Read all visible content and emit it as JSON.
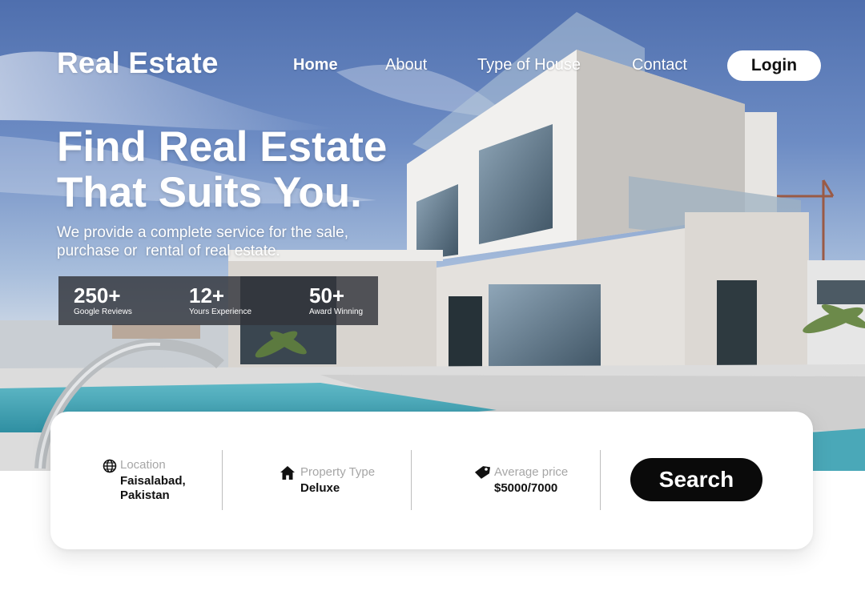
{
  "brand": {
    "logo": "Real Estate"
  },
  "nav": {
    "items": [
      {
        "label": "Home",
        "active": true
      },
      {
        "label": "About",
        "active": false
      },
      {
        "label": "Type of House",
        "active": false
      },
      {
        "label": "Contact",
        "active": false
      }
    ],
    "login_label": "Login"
  },
  "hero": {
    "headline_line1": "Find Real Estate",
    "headline_line2": "That Suits You.",
    "subtext_line1": "We provide a complete service for the sale,",
    "subtext_line2": "purchase or  rental of real estate."
  },
  "stats": [
    {
      "value": "250+",
      "label": "Google Reviews"
    },
    {
      "value": "12+",
      "label": "Yours Experience"
    },
    {
      "value": "50+",
      "label": "Award Winning"
    }
  ],
  "search": {
    "location": {
      "label": "Location",
      "value_line1": "Faisalabad,",
      "value_line2": "Pakistan",
      "icon": "globe-icon"
    },
    "property_type": {
      "label": "Property Type",
      "value": "Deluxe",
      "icon": "home-icon"
    },
    "price": {
      "label": "Average price",
      "value": "$5000/7000",
      "icon": "price-tag-icon"
    },
    "button_label": "Search"
  },
  "colors": {
    "primary": "#0a0a0a",
    "text_light": "#ffffff",
    "label_gray": "#a6a6a6",
    "stats_bg": "#32343a"
  }
}
